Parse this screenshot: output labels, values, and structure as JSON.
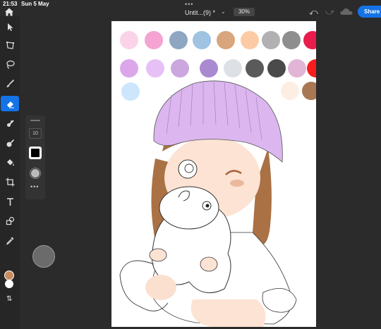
{
  "status_bar": {
    "time": "21:53",
    "date": "Sun 5 May",
    "grabber": "•••"
  },
  "header": {
    "title": "Untit...(9) *",
    "title_chevron": "⌄",
    "zoom": "30%",
    "share_label": "Share"
  },
  "brush_panel": {
    "size": "10",
    "more": "•••",
    "color": "#000000"
  },
  "colors": {
    "accent": "#1473e6",
    "foreground": "#c98c5e",
    "background": "#ffffff",
    "canvas_bg": "#2b2b2b"
  },
  "icons": {
    "home": "home-icon",
    "select": "arrow-icon",
    "transform": "transform-icon",
    "lasso": "lasso-icon",
    "brush": "brush-icon",
    "eraser": "eraser-icon",
    "smudge": "smudge-icon",
    "blur": "blur-icon",
    "fill": "paint-bucket-icon",
    "crop": "crop-icon",
    "type": "type-icon",
    "shapes": "shapes-icon",
    "eyedropper": "eyedropper-icon",
    "undo": "undo-icon",
    "redo": "redo-icon",
    "cloud": "cloud-icon",
    "swap": "swap-colors-icon"
  },
  "palette_swatches": [
    "#fbd3e9",
    "#f5a3d3",
    "#8fa6c2",
    "#9fc3e0",
    "#d9a57c",
    "#fccba5",
    "#b3b0b3",
    "#8e8e8e",
    "#e81d4c",
    "#dca7ea",
    "#e7c0f5",
    "#caa8df",
    "#a98ad1",
    "#dde1e6",
    "#5a5a5a",
    "#4a4a4a",
    "#e2b5d6",
    "#f91c1c",
    "#fdeee4",
    "#a87855",
    "#cde6fb"
  ]
}
